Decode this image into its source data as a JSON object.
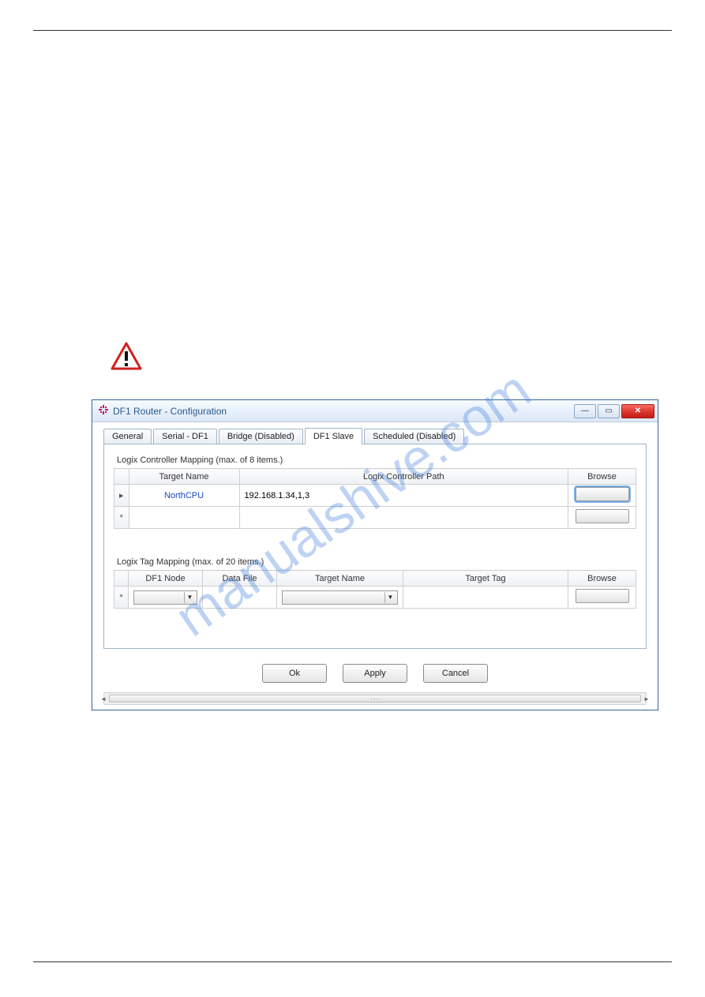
{
  "watermark": "manualshive.com",
  "window": {
    "title": "DF1 Router - Configuration"
  },
  "tabs": {
    "general": "General",
    "serial": "Serial - DF1",
    "bridge": "Bridge (Disabled)",
    "df1slave": "DF1 Slave",
    "scheduled": "Scheduled (Disabled)"
  },
  "controllerMapping": {
    "label": "Logix Controller Mapping (max. of 8 items.)",
    "headers": {
      "target": "Target Name",
      "path": "Logix Controller Path",
      "browse": "Browse"
    },
    "rows": [
      {
        "marker": "▸",
        "target": "NorthCPU",
        "path": "192.168.1.34,1,3"
      },
      {
        "marker": "*",
        "target": "",
        "path": ""
      }
    ]
  },
  "tagMapping": {
    "label": "Logix Tag Mapping (max. of 20 items.)",
    "headers": {
      "node": "DF1 Node",
      "file": "Data File",
      "target": "Target Name",
      "tag": "Target Tag",
      "browse": "Browse"
    },
    "row": {
      "marker": "*"
    }
  },
  "buttons": {
    "ok": "Ok",
    "apply": "Apply",
    "cancel": "Cancel"
  }
}
